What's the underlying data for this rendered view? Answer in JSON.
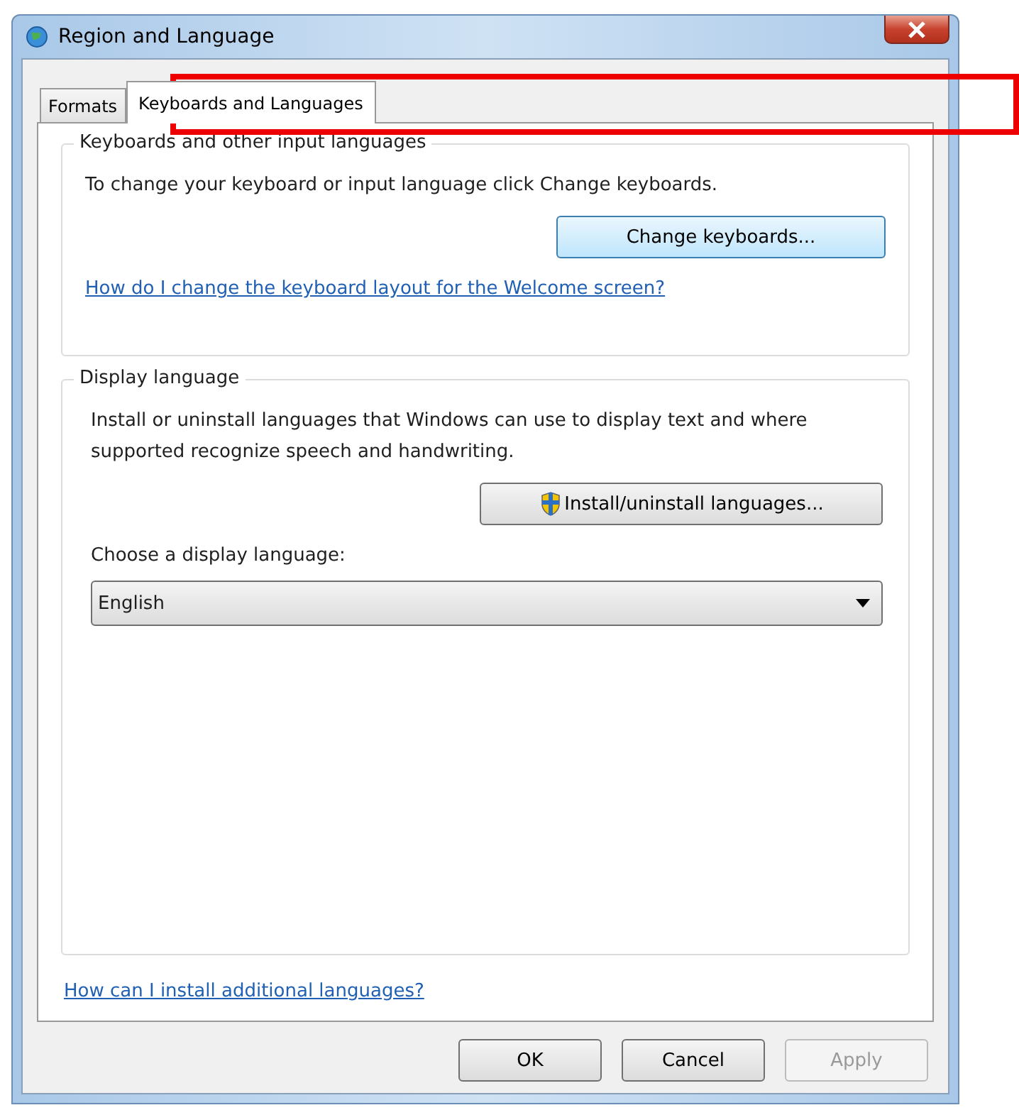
{
  "window": {
    "title": "Region and Language"
  },
  "tabs": [
    {
      "label": "Formats",
      "selected": false
    },
    {
      "label": "Keyboards and Languages",
      "selected": true
    }
  ],
  "keyboards_group": {
    "title": "Keyboards and other input languages",
    "text": "To change your keyboard or input language click Change keyboards.",
    "button": "Change keyboards...",
    "link": "How do I change the keyboard layout for the Welcome screen?"
  },
  "display_group": {
    "title": "Display language",
    "text": "Install or uninstall languages that Windows can use to display text and where supported recognize speech and handwriting.",
    "button": "Install/uninstall languages...",
    "dropdown_label": "Choose a display language:",
    "dropdown": {
      "value": "English"
    }
  },
  "link": "How can I install additional languages?",
  "buttons": [
    {
      "label": "OK",
      "disabled": false
    },
    {
      "label": "Cancel",
      "disabled": false
    },
    {
      "label": "Apply",
      "disabled": true
    }
  ]
}
